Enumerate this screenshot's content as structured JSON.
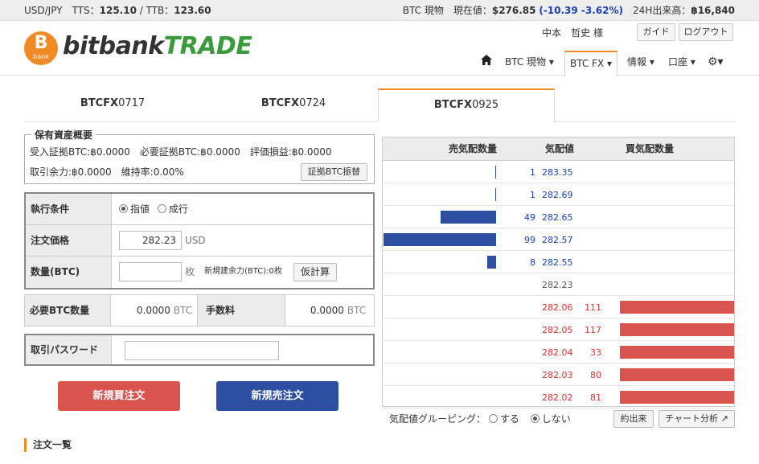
{
  "topbar": {
    "pair": "USD/JPY",
    "tts_label": "TTS：",
    "tts": "125.10",
    "sep": " / TTB：",
    "ttb": "123.60",
    "btc_label": "BTC 現物　現在値：",
    "price": "$276.85",
    "change": "(-10.39 -3.62%)",
    "vol_label": "24H出来高：",
    "vol": "฿16,840"
  },
  "brand": {
    "logo_glyph": "B",
    "logo_small": "bank",
    "name1": "bitbank",
    "name2": "TRADE"
  },
  "header": {
    "user": "中本　哲史 様",
    "guide": "ガイド",
    "logout": "ログアウト"
  },
  "nav": {
    "home_icon": "home-icon",
    "spot": "BTC 現物 ▾",
    "fx": "BTC FX ▾",
    "info": "情報 ▾",
    "account": "口座 ▾",
    "settings_icon": "⚙▾"
  },
  "tabs": [
    {
      "b": "BTCFX",
      "n": "0717"
    },
    {
      "b": "BTCFX",
      "n": "0724"
    },
    {
      "b": "BTCFX",
      "n": "0925"
    }
  ],
  "assets": {
    "title": "保有資産概要",
    "line1": "受入証拠BTC:฿0.0000　必要証拠BTC:฿0.0000　評価損益:฿0.0000",
    "line2": "取引余力:฿0.0000　維持率:0.00%",
    "transfer_btn": "証拠BTC振替"
  },
  "form": {
    "cond_label": "執行条件",
    "limit": "指値",
    "market": "成行",
    "price_label": "注文価格",
    "price": "282.23",
    "price_unit": "USD",
    "qty_label": "数量(BTC)",
    "qty": "",
    "qty_unit": "枚",
    "qty_note": "新規建余力(BTC):0枚",
    "calc_btn": "仮計算"
  },
  "required": {
    "label": "必要BTC数量",
    "value": "0.0000",
    "unit": "BTC",
    "fee_label": "手数料",
    "fee": "0.0000",
    "fee_unit": "BTC"
  },
  "password": {
    "label": "取引パスワード",
    "value": ""
  },
  "buttons": {
    "buy": "新規買注文",
    "sell": "新規売注文"
  },
  "book": {
    "h_sell": "売気配数量",
    "h_price": "気配値",
    "h_buy": "買気配数量",
    "asks": [
      {
        "q": "1",
        "p": "283.35"
      },
      {
        "q": "1",
        "p": "282.69"
      },
      {
        "q": "49",
        "p": "282.65"
      },
      {
        "q": "99",
        "p": "282.57"
      },
      {
        "q": "8",
        "p": "282.55"
      }
    ],
    "mid": "282.23",
    "bids": [
      {
        "p": "282.06",
        "q": "111"
      },
      {
        "p": "282.05",
        "q": "117"
      },
      {
        "p": "282.04",
        "q": "33"
      },
      {
        "p": "282.03",
        "q": "80"
      },
      {
        "p": "282.02",
        "q": "81"
      }
    ]
  },
  "bookfoot": {
    "grouping": "気配値グルーピング：",
    "on": "する",
    "off": "しない",
    "trades": "約出来",
    "chart": "チャート分析"
  },
  "orders": {
    "title": "注文一覧"
  },
  "colors": {
    "accent": "#f08a24",
    "buy": "#d9534f",
    "sell": "#2d4fa1",
    "brand_green": "#3b9a3b"
  }
}
